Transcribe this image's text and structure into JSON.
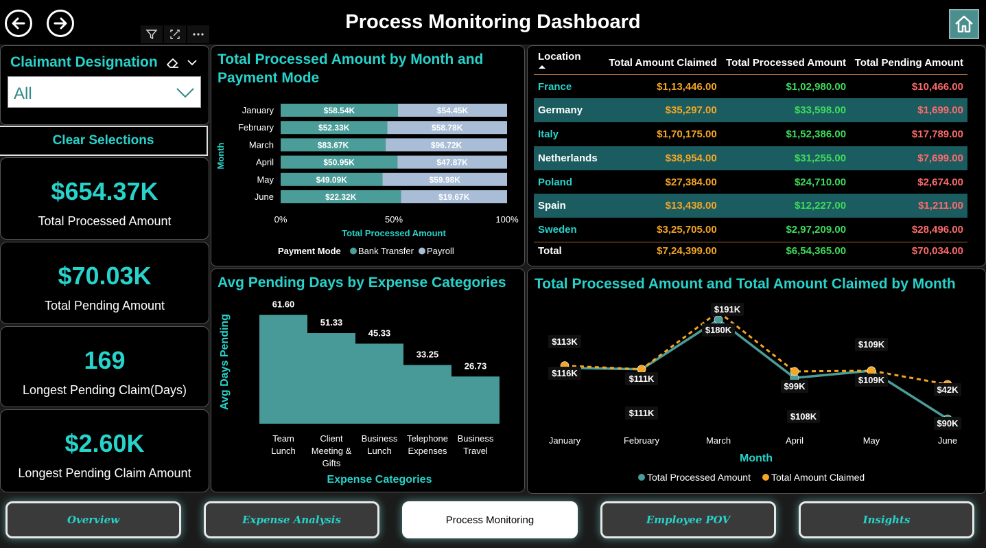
{
  "header": {
    "title": "Process Monitoring Dashboard"
  },
  "slicer": {
    "title": "Claimant Designation",
    "value": "All"
  },
  "clear_label": "Clear Selections",
  "kpis": [
    {
      "value": "$654.37K",
      "label": "Total Processed Amount"
    },
    {
      "value": "$70.03K",
      "label": "Total Pending Amount"
    },
    {
      "value": "169",
      "label": "Longest Pending Claim(Days)"
    },
    {
      "value": "$2.60K",
      "label": "Longest Pending Claim Amount"
    }
  ],
  "stacked": {
    "title_line1": "Total Processed Amount by Month and",
    "title_line2": "Payment Mode",
    "ylabel": "Month",
    "xlabel": "Total Processed Amount",
    "legend_title": "Payment Mode",
    "colors": {
      "bank": "#4a9d98",
      "payroll": "#a9bdd6"
    }
  },
  "pending_days": {
    "title": "Avg Pending Days by Expense Categories",
    "ylabel": "Avg Days Pending",
    "xlabel": "Expense Categories",
    "color": "#479a97"
  },
  "location_table": {
    "headers": [
      "Location",
      "Total Amount Claimed",
      "Total Processed Amount",
      "Total Pending Amount"
    ],
    "rows": [
      [
        "France",
        "$1,13,446.00",
        "$1,02,980.00",
        "$10,466.00"
      ],
      [
        "Germany",
        "$35,297.00",
        "$33,598.00",
        "$1,699.00"
      ],
      [
        "Italy",
        "$1,70,175.00",
        "$1,52,386.00",
        "$17,789.00"
      ],
      [
        "Netherlands",
        "$38,954.00",
        "$31,255.00",
        "$7,699.00"
      ],
      [
        "Poland",
        "$27,384.00",
        "$24,710.00",
        "$2,674.00"
      ],
      [
        "Spain",
        "$13,438.00",
        "$12,227.00",
        "$1,211.00"
      ],
      [
        "Sweden",
        "$3,25,705.00",
        "$2,97,209.00",
        "$28,496.00"
      ]
    ],
    "total": [
      "Total",
      "$7,24,399.00",
      "$6,54,365.00",
      "$70,034.00"
    ]
  },
  "line_chart": {
    "title": "Total Processed Amount and Total Amount Claimed by Month",
    "xlabel": "Month",
    "colors": {
      "processed": "#4a9d98",
      "claimed": "#f5a623"
    }
  },
  "tabs": [
    {
      "label": "Overview",
      "active": false
    },
    {
      "label": "Expense Analysis",
      "active": false
    },
    {
      "label": "Process Monitoring",
      "active": true
    },
    {
      "label": "Employee POV",
      "active": false
    },
    {
      "label": "Insights",
      "active": false
    }
  ],
  "chart_data": [
    {
      "type": "bar",
      "orientation": "horizontal-100%-stacked",
      "title": "Total Processed Amount by Month and Payment Mode",
      "xlabel": "Total Processed Amount",
      "ylabel": "Month",
      "categories": [
        "January",
        "February",
        "March",
        "April",
        "May",
        "June"
      ],
      "series": [
        {
          "name": "Bank Transfer",
          "values": [
            58.54,
            52.33,
            83.67,
            50.95,
            49.09,
            22.32
          ],
          "labels": [
            "$58.54K",
            "$52.33K",
            "$83.67K",
            "$50.95K",
            "$49.09K",
            "$22.32K"
          ]
        },
        {
          "name": "Payroll",
          "values": [
            54.45,
            58.78,
            96.72,
            47.87,
            59.98,
            19.67
          ],
          "labels": [
            "$54.45K",
            "$58.78K",
            "$96.72K",
            "$47.87K",
            "$59.98K",
            "$19.67K"
          ]
        }
      ],
      "xticks": [
        "0%",
        "50%",
        "100%"
      ],
      "legend": "bottom"
    },
    {
      "type": "bar",
      "title": "Avg Pending Days by Expense Categories",
      "xlabel": "Expense Categories",
      "ylabel": "Avg Days Pending",
      "categories": [
        [
          "Team",
          "Lunch"
        ],
        [
          "Client",
          "Meeting &",
          "Gifts"
        ],
        [
          "Business",
          "Lunch"
        ],
        [
          "Telephone",
          "Expenses"
        ],
        [
          "Business",
          "Travel"
        ]
      ],
      "values": [
        61.6,
        51.33,
        45.33,
        33.25,
        26.73
      ],
      "labels": [
        "61.60",
        "51.33",
        "45.33",
        "33.25",
        "26.73"
      ],
      "ylim": [
        0,
        70
      ]
    },
    {
      "type": "line",
      "title": "Total Processed Amount and Total Amount Claimed by Month",
      "xlabel": "Month",
      "categories": [
        "January",
        "February",
        "March",
        "April",
        "May",
        "June"
      ],
      "series": [
        {
          "name": "Total Processed Amount",
          "values": [
            113,
            111,
            180,
            99,
            109,
            42
          ],
          "labels": [
            "$113K",
            "$111K",
            "$180K",
            "$99K",
            "$109K",
            "$42K"
          ]
        },
        {
          "name": "Total Amount Claimed",
          "values": [
            116,
            111,
            191,
            108,
            109,
            90
          ],
          "labels": [
            "$116K",
            "$111K",
            "$191K",
            "$108K",
            "$109K",
            "$90K"
          ]
        }
      ],
      "legend": "bottom"
    }
  ]
}
